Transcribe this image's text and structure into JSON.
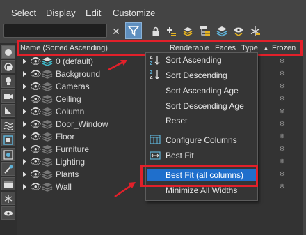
{
  "menubar": {
    "items": [
      "Select",
      "Display",
      "Edit",
      "Customize"
    ]
  },
  "toolbar": {
    "search_placeholder": "",
    "close_glyph": "✕"
  },
  "columns": {
    "name": "Name (Sorted Ascending)",
    "renderable": "Renderable",
    "faces": "Faces",
    "type": "Type",
    "frozen": "Frozen",
    "sort_marker": "▲"
  },
  "rows": [
    {
      "label": "0 (default)"
    },
    {
      "label": "Background"
    },
    {
      "label": "Cameras"
    },
    {
      "label": "Ceiling"
    },
    {
      "label": "Column"
    },
    {
      "label": "Door_Window"
    },
    {
      "label": "Floor"
    },
    {
      "label": "Furniture"
    },
    {
      "label": "Lighting"
    },
    {
      "label": "Plants"
    },
    {
      "label": "Wall"
    }
  ],
  "context_menu": {
    "sort_ascending": "Sort Ascending",
    "sort_descending": "Sort Descending",
    "sort_ascending_age": "Sort Ascending Age",
    "sort_descending_age": "Sort Descending Age",
    "reset": "Reset",
    "configure_columns": "Configure Columns",
    "best_fit": "Best Fit",
    "best_fit_all": "Best Fit (all columns)",
    "minimize_all": "Minimize All Widths"
  },
  "icons": {
    "frozen": "❄",
    "eye": "👁"
  },
  "colors": {
    "highlight": "#1f6fcc",
    "annotation": "#e2202a",
    "accent": "#5e8fbf"
  }
}
